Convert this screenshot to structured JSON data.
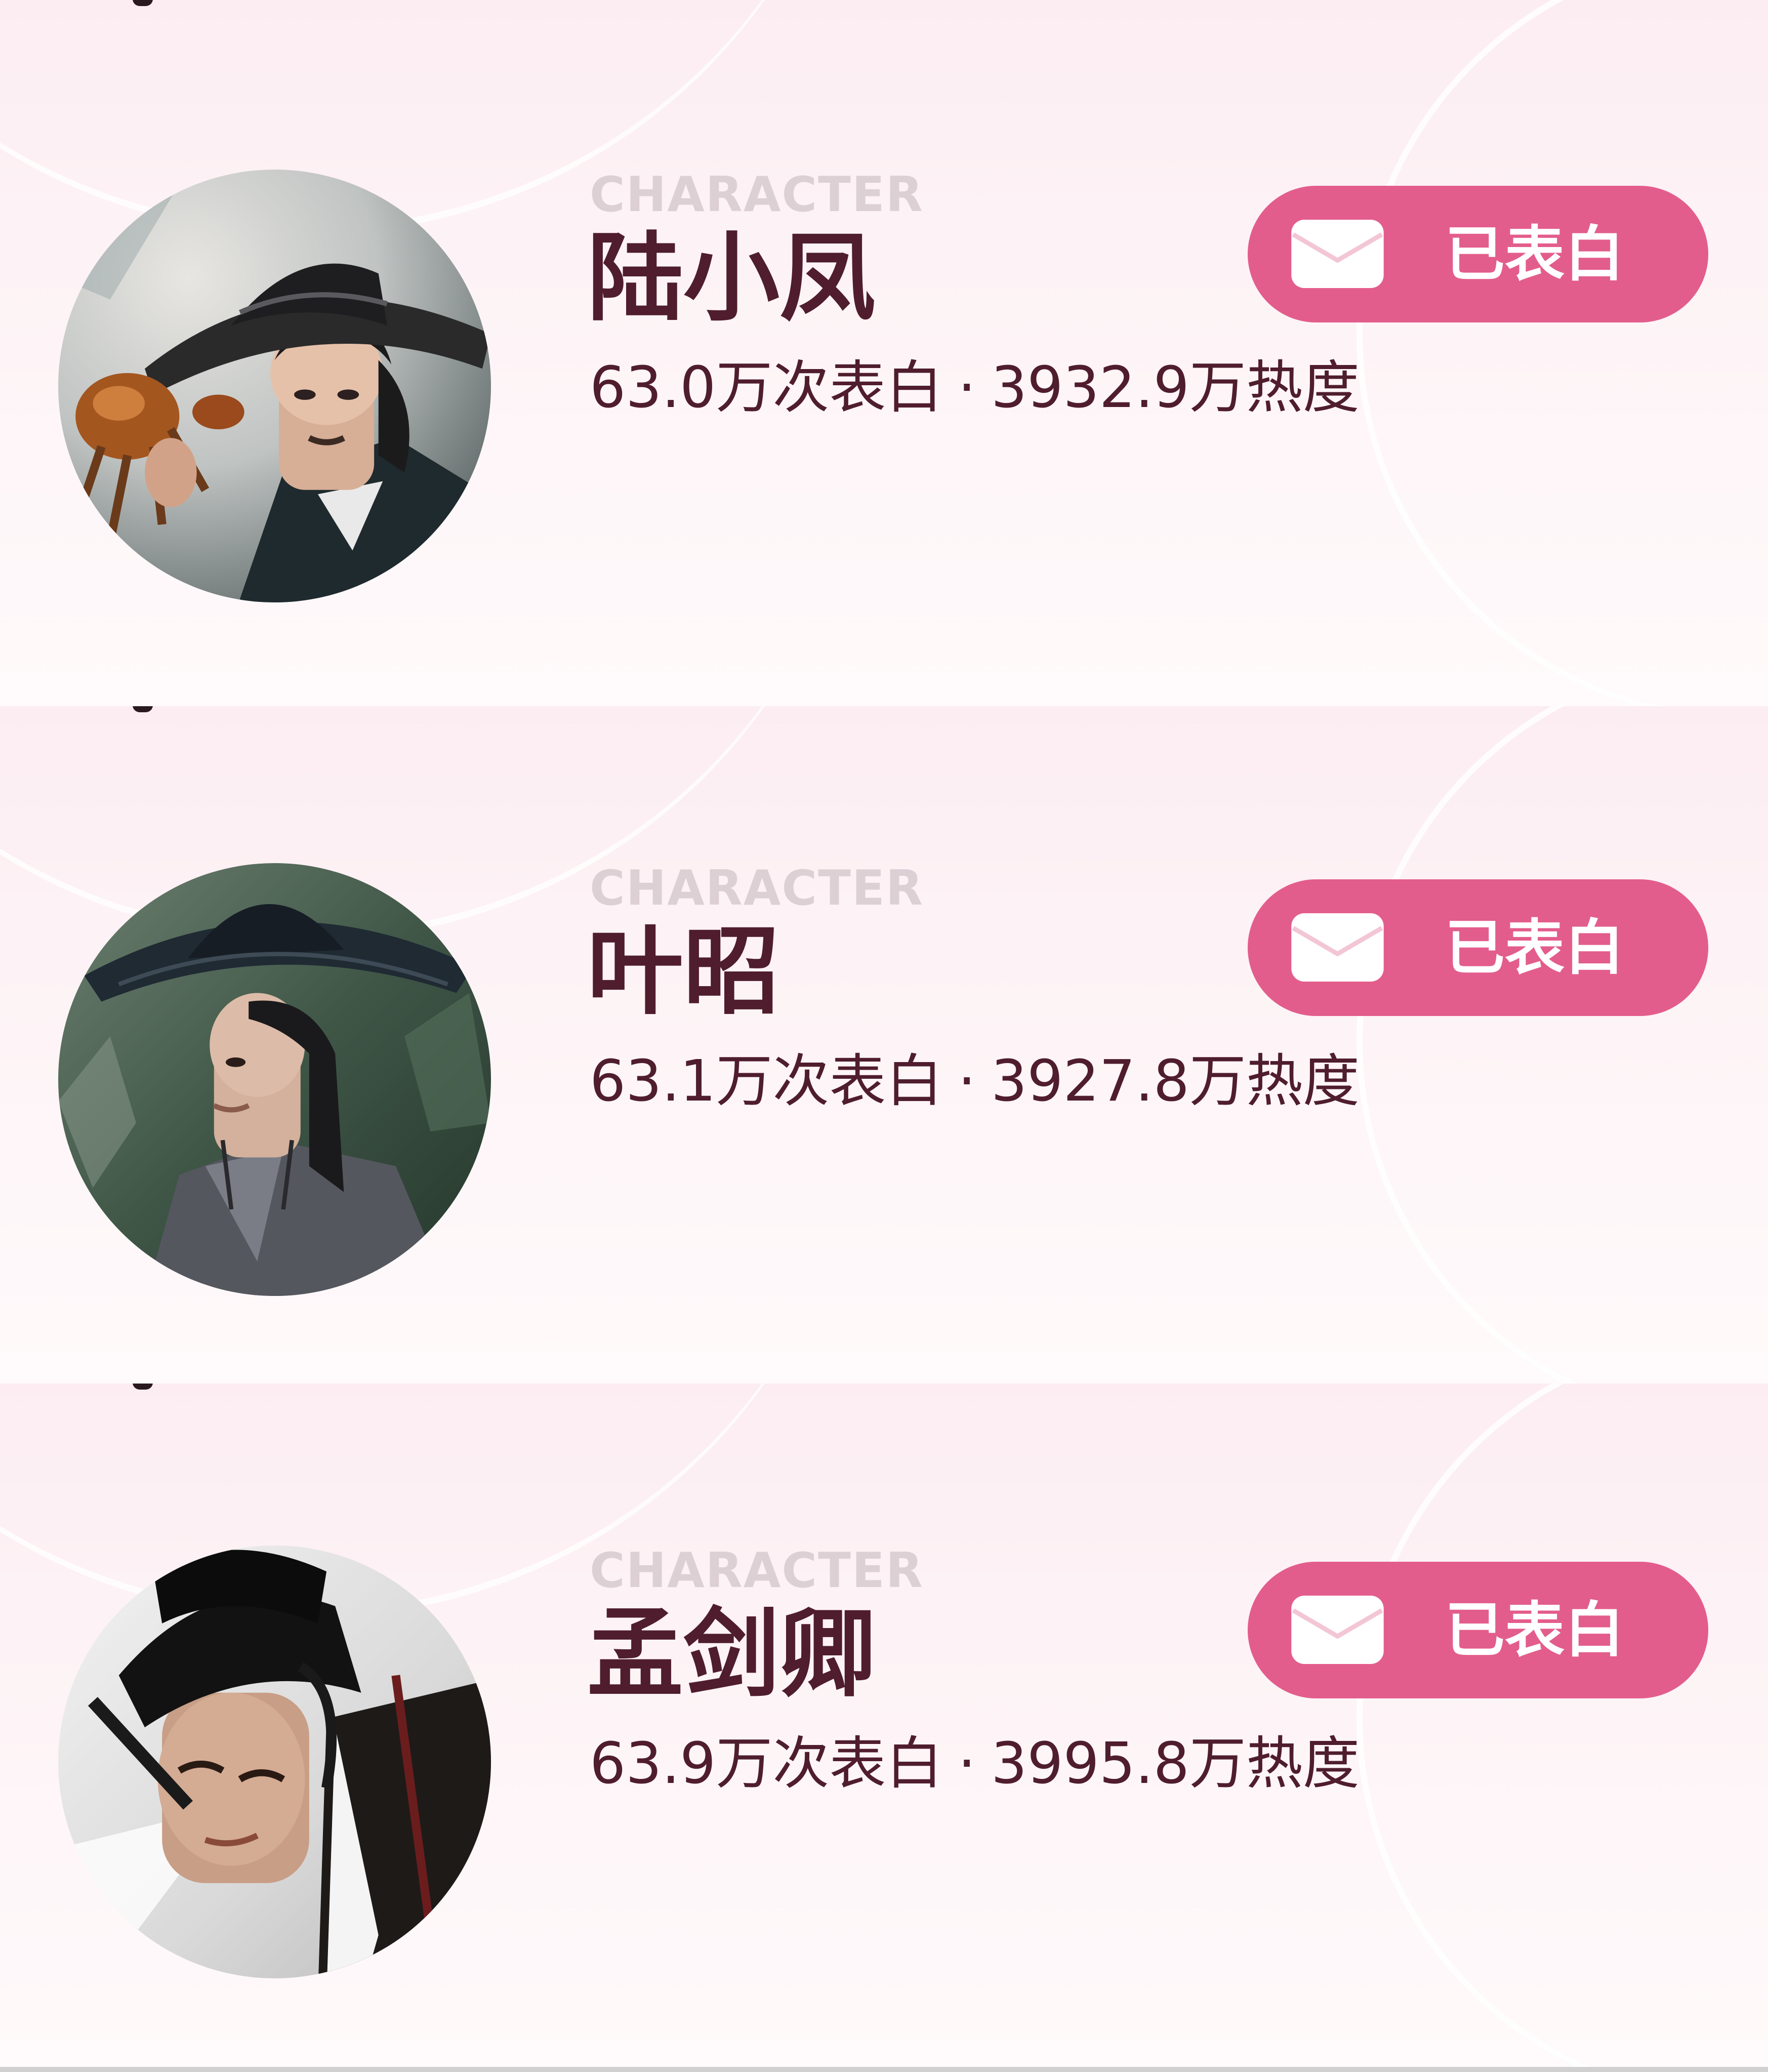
{
  "colors": {
    "accent": "#e35d8c",
    "name_text": "#4f1d2e",
    "label_character": "#ddd0d5",
    "card_bg": "#fdf3f6"
  },
  "characters": [
    {
      "label": "CHARACTER",
      "name": "陆小凤",
      "confessions": "63.0万次表白",
      "separator": "·",
      "heat": "3932.9万热度",
      "button_label": "已表白",
      "button_icon": "envelope-icon",
      "avatar": "character-portrait-wide-hat-holding-crab"
    },
    {
      "label": "CHARACTER",
      "name": "叶昭",
      "confessions": "63.1万次表白",
      "separator": "·",
      "heat": "3927.8万热度",
      "button_label": "已表白",
      "button_icon": "envelope-icon",
      "avatar": "character-portrait-bamboo-hat-forest"
    },
    {
      "label": "CHARACTER",
      "name": "孟剑卿",
      "confessions": "63.9万次表白",
      "separator": "·",
      "heat": "3995.8万热度",
      "button_label": "已表白",
      "button_icon": "envelope-icon",
      "avatar": "character-portrait-black-official-hat"
    }
  ]
}
